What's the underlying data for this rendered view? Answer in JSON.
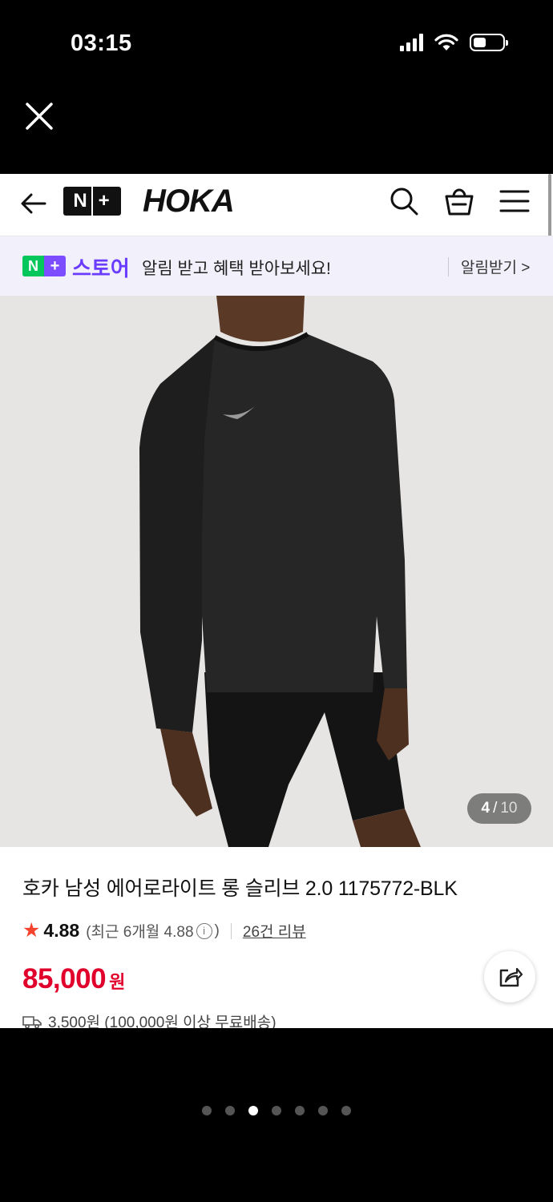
{
  "status_bar": {
    "time": "03:15",
    "battery_level": 0.45
  },
  "modal": {
    "close_icon": "close-icon"
  },
  "header": {
    "back_icon": "arrow-left-icon",
    "nplus_logo": "N+",
    "brand_logo": "HOKA",
    "search_icon": "search-icon",
    "cart_icon": "shopping-bag-icon",
    "menu_icon": "hamburger-menu-icon"
  },
  "notice": {
    "badge": "N+",
    "store_name": "스토어",
    "message": "알림 받고 혜택 받아보세요!",
    "action": "알림받기 >"
  },
  "gallery": {
    "current": "4",
    "separator": "/",
    "total": "10"
  },
  "product": {
    "title": "호카 남성 에어로라이트 롱 슬리브 2.0 1175772-BLK",
    "rating": "4.88",
    "recent_rating_label": "(최근 6개월 4.88",
    "recent_rating_close": ")",
    "review_link": "26건 리뷰",
    "price": "85,000",
    "currency": "원",
    "shipping": "3,500원 (100,000원 이상 무료배송)"
  },
  "colors": {
    "price_red": "#e0002b",
    "store_purple": "#6a3cff",
    "naver_green": "#03c75a",
    "star_color": "#f4442e"
  },
  "page_dots": {
    "count": 7,
    "active_index": 2
  }
}
